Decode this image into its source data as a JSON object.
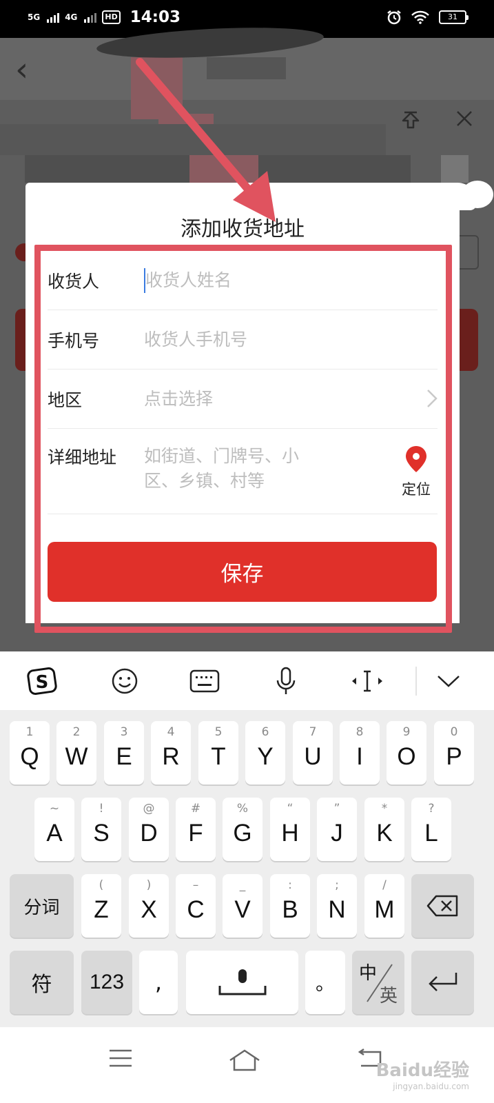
{
  "status_bar": {
    "network_1": "5G",
    "network_2": "4G",
    "hd_badge": "HD",
    "time": "14:03",
    "battery": "31"
  },
  "dialog": {
    "title": "添加收货地址",
    "fields": [
      {
        "label": "收货人",
        "placeholder": "收货人姓名"
      },
      {
        "label": "手机号",
        "placeholder": "收货人手机号"
      },
      {
        "label": "地区",
        "placeholder": "点击选择"
      },
      {
        "label": "详细地址",
        "placeholder_line1": "如街道、门牌号、小",
        "placeholder_line2": "区、乡镇、村等"
      }
    ],
    "locate_label": "定位",
    "save_label": "保存"
  },
  "keyboard": {
    "row1": [
      {
        "hint": "1",
        "key": "Q"
      },
      {
        "hint": "2",
        "key": "W"
      },
      {
        "hint": "3",
        "key": "E"
      },
      {
        "hint": "4",
        "key": "R"
      },
      {
        "hint": "5",
        "key": "T"
      },
      {
        "hint": "6",
        "key": "Y"
      },
      {
        "hint": "7",
        "key": "U"
      },
      {
        "hint": "8",
        "key": "I"
      },
      {
        "hint": "9",
        "key": "O"
      },
      {
        "hint": "0",
        "key": "P"
      }
    ],
    "row2": [
      {
        "hint": "~",
        "key": "A"
      },
      {
        "hint": "!",
        "key": "S"
      },
      {
        "hint": "@",
        "key": "D"
      },
      {
        "hint": "#",
        "key": "F"
      },
      {
        "hint": "%",
        "key": "G"
      },
      {
        "hint": "“",
        "key": "H"
      },
      {
        "hint": "”",
        "key": "J"
      },
      {
        "hint": "*",
        "key": "K"
      },
      {
        "hint": "?",
        "key": "L"
      }
    ],
    "row3": [
      {
        "hint": "(",
        "key": "Z"
      },
      {
        "hint": ")",
        "key": "X"
      },
      {
        "hint": "–",
        "key": "C"
      },
      {
        "hint": "_",
        "key": "V"
      },
      {
        "hint": ":",
        "key": "B"
      },
      {
        "hint": ";",
        "key": "N"
      },
      {
        "hint": "/",
        "key": "M"
      }
    ],
    "split_label": "分词",
    "symbol_label": "符",
    "num_label": "123",
    "comma_label": ",",
    "period_label": "。",
    "lang_top": "中",
    "lang_bottom": "英"
  },
  "watermark": {
    "text": "Baidu经验",
    "sub": "jingyan.baidu.com"
  },
  "colors": {
    "accent": "#e0302a",
    "highlight": "#e0535f",
    "caret": "#3a7be0"
  }
}
